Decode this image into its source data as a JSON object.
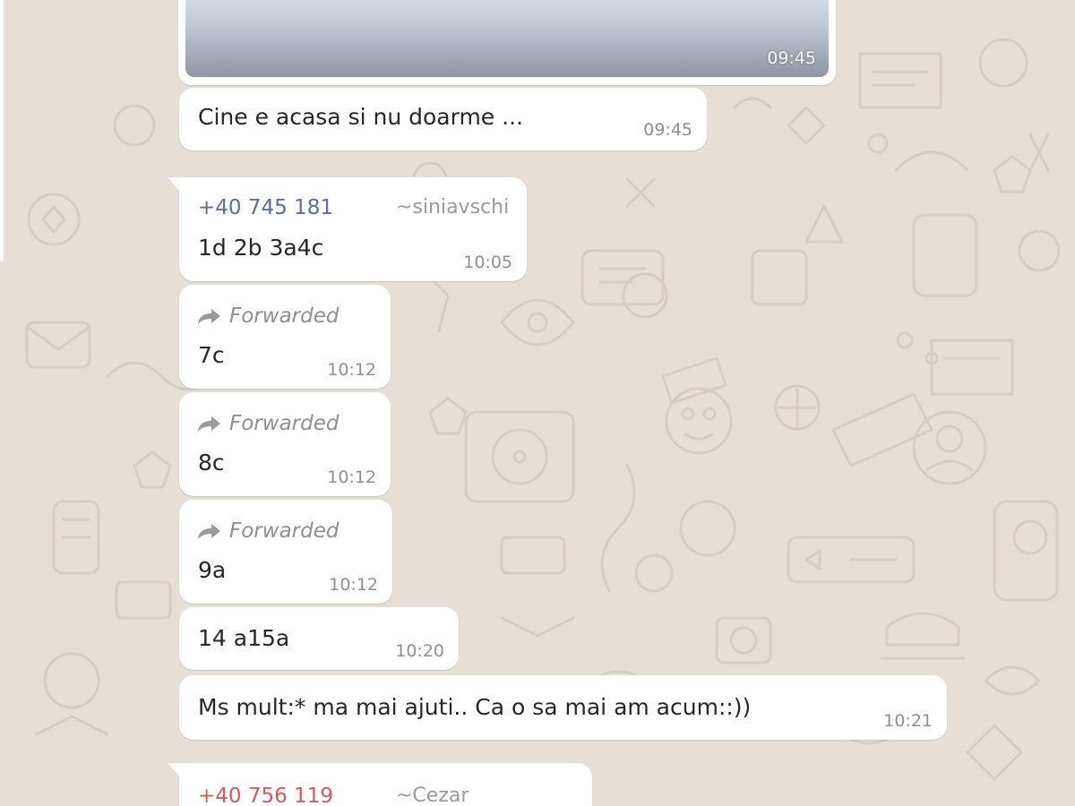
{
  "messages": [
    {
      "id": "image",
      "time": "09:45"
    },
    {
      "id": "m1",
      "text": "Cine e acasa si nu doarme ...",
      "time": "09:45"
    },
    {
      "id": "m2",
      "sender_phone": "+40 745 181",
      "sender_name": "~siniavschi",
      "text": "1d 2b 3a4c",
      "time": "10:05"
    },
    {
      "id": "m3",
      "forwarded": "Forwarded",
      "text": "7c",
      "time": "10:12"
    },
    {
      "id": "m4",
      "forwarded": "Forwarded",
      "text": "8c",
      "time": "10:12"
    },
    {
      "id": "m5",
      "forwarded": "Forwarded",
      "text": "9a",
      "time": "10:12"
    },
    {
      "id": "m6",
      "text": "14 a15a",
      "time": "10:20"
    },
    {
      "id": "m7",
      "text": "Ms mult:* ma mai ajuti.. Ca o sa mai am acum::))",
      "time": "10:21"
    },
    {
      "id": "m8",
      "sender_phone": "+40 756 119",
      "sender_name": "~Cezar"
    }
  ],
  "colors": {
    "background": "#e6dfd7",
    "bubble": "#ffffff",
    "sender_blue": "#5b6f9a",
    "sender_red": "#d8585c",
    "timestamp": "#8f8f8f"
  },
  "icons": [
    "forward-arrow-icon"
  ]
}
